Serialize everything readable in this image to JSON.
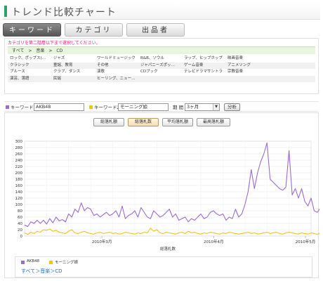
{
  "header": {
    "title": "トレンド比較チャート"
  },
  "tabs": [
    {
      "label": "キーワード",
      "active": true
    },
    {
      "label": "カテゴリ",
      "active": false
    },
    {
      "label": "出品者",
      "active": false
    }
  ],
  "category": {
    "instruction": "カテゴリを第二階層以下まで選択してください。",
    "breadcrumb": "すべて　>　音楽　>　CD",
    "rows": [
      [
        "ロック、ポップス(…",
        "ジャズ",
        "ワールドミュージック",
        "R&B、ソウル",
        "ラップ、ヒップホップ",
        "映画音楽"
      ],
      [
        "クラシック",
        "童謡、教育",
        "その他",
        "ジャパニーズポッ…",
        "ゲーム音楽",
        "アニメソング"
      ],
      [
        "ブルース",
        "クラブ、ダンス",
        "演歌",
        "CDブック",
        "テレビドラマサントラ",
        "宗教音楽"
      ],
      [
        "演芸、落語",
        "民謡",
        "ヒーリング、ニュー…",
        "",
        "",
        ""
      ]
    ]
  },
  "keywords": {
    "kw1_label": "キーワード1",
    "kw1_value": "AKB48",
    "kw1_color": "#9b6bcf",
    "kw2_label": "キーワード2",
    "kw2_value": "モーニング娘",
    "kw2_color": "#f2c21d",
    "period_label": "期 間",
    "period_value": "3ヶ月",
    "analyze_label": "分析"
  },
  "chart_buttons": [
    {
      "label": "総落札額",
      "active": false
    },
    {
      "label": "総落札数",
      "active": true
    },
    {
      "label": "平均落札額",
      "active": false
    },
    {
      "label": "最高落札額",
      "active": false
    }
  ],
  "chart_data": {
    "type": "line",
    "xlabel": "総落札数",
    "ylabel": "",
    "ylim": [
      0,
      300
    ],
    "yticks": [
      0,
      20,
      40,
      60,
      80,
      100,
      120,
      140,
      160,
      180,
      200,
      220,
      240,
      260,
      280,
      300
    ],
    "xtick_labels": [
      "2010年3月",
      "2010年4月",
      "2010年5月"
    ],
    "x_count": 92,
    "grid": true,
    "legend_position": "bottom",
    "series": [
      {
        "name": "AKB48",
        "color": "#9b6bcf",
        "values": [
          35,
          30,
          45,
          40,
          50,
          40,
          50,
          38,
          55,
          42,
          60,
          48,
          52,
          45,
          70,
          60,
          85,
          75,
          105,
          80,
          90,
          85,
          65,
          70,
          60,
          68,
          75,
          65,
          70,
          80,
          60,
          95,
          55,
          65,
          70,
          80,
          60,
          90,
          75,
          60,
          55,
          80,
          70,
          60,
          65,
          75,
          85,
          60,
          70,
          50,
          55,
          60,
          45,
          55,
          50,
          60,
          70,
          55,
          60,
          75,
          80,
          70,
          65,
          70,
          50,
          60,
          55,
          85,
          60,
          70,
          100,
          140,
          210,
          150,
          200,
          235,
          260,
          295,
          180,
          170,
          160,
          150,
          145,
          155,
          270,
          130,
          150,
          120,
          150,
          110,
          95,
          120,
          80,
          75,
          90,
          100
        ]
      },
      {
        "name": "モーニング娘",
        "color": "#f2c21d",
        "values": [
          10,
          5,
          12,
          8,
          15,
          12,
          20,
          18,
          22,
          15,
          18,
          12,
          10,
          8,
          15,
          20,
          10,
          8,
          12,
          15,
          10,
          8,
          6,
          10,
          12,
          8,
          10,
          12,
          8,
          10,
          6,
          8,
          12,
          10,
          8,
          6,
          10,
          8,
          12,
          10,
          25,
          15,
          20,
          10,
          8,
          12,
          10,
          8,
          6,
          10,
          12,
          8,
          15,
          10,
          12,
          8,
          6,
          10,
          8,
          12,
          10,
          8,
          6,
          10,
          8,
          12,
          10,
          8,
          6,
          8,
          10,
          12,
          8,
          10,
          6,
          8,
          10,
          12,
          8,
          10,
          12,
          8,
          6,
          10,
          12,
          10,
          8,
          6,
          10,
          8,
          6,
          10,
          8,
          5,
          10,
          8
        ]
      }
    ]
  },
  "legend": {
    "items": [
      "AKB48",
      "モーニング娘"
    ],
    "breadcrumb": "すべて＞音楽＞CD"
  }
}
